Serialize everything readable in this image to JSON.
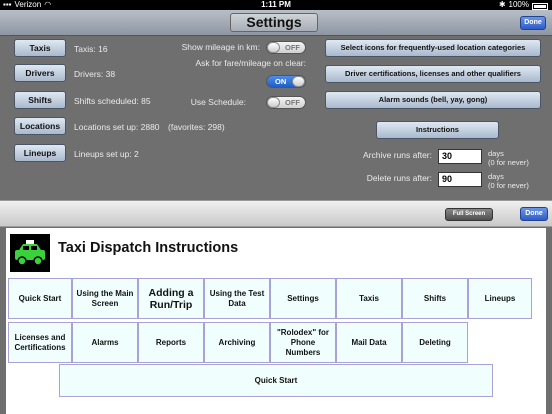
{
  "status_bar": {
    "carrier": "Verizon",
    "time": "1:11 PM",
    "battery": "100%"
  },
  "header": {
    "title": "Settings",
    "done_label": "Done"
  },
  "settings": {
    "nav_buttons": [
      "Taxis",
      "Drivers",
      "Shifts",
      "Locations",
      "Lineups"
    ],
    "info": {
      "taxis": "Taxis: 16",
      "drivers": "Drivers: 38",
      "shifts": "Shifts scheduled: 85",
      "locations": "Locations set up: 2880",
      "favorites": "(favorites: 298)",
      "lineups": "Lineups set up: 2"
    },
    "show_mileage": {
      "label": "Show mileage in km:",
      "state": "OFF"
    },
    "ask_fare": {
      "label": "Ask for fare/mileage on clear:",
      "state": "ON"
    },
    "use_schedule": {
      "label": "Use Schedule:",
      "state": "OFF"
    },
    "action_buttons": {
      "icons": "Select icons for frequently-used location categories",
      "certifications": "Driver certifications, licenses and other qualifiers",
      "alarm_sounds": "Alarm sounds (bell, yay, gong)",
      "instructions": "Instructions"
    },
    "archive": {
      "label": "Archive runs after:",
      "value": "30",
      "unit": "days",
      "note": "(0 for never)"
    },
    "delete": {
      "label": "Delete runs after:",
      "value": "90",
      "unit": "days",
      "note": "(0 for never)"
    }
  },
  "toolbar": {
    "full_screen_label": "Full Screen",
    "done_label": "Done"
  },
  "instructions_doc": {
    "title": "Taxi Dispatch Instructions",
    "row1": [
      "Quick Start",
      "Using the Main Screen",
      "Adding a Run/Trip",
      "Using the Test Data",
      "Settings",
      "Taxis",
      "Shifts",
      "Lineups"
    ],
    "row2": [
      "Licenses and Certifications",
      "Alarms",
      "Reports",
      "Archiving",
      "\"Rolodex\" for Phone Numbers",
      "Mail Data",
      "Deleting"
    ],
    "section_heading": "Quick Start"
  },
  "colors": {
    "accent_blue": "#2e5cc7",
    "cell_bg": "#f0fffe",
    "cell_border": "#a9a2d6",
    "panel_bg": "#6f6f6f"
  }
}
